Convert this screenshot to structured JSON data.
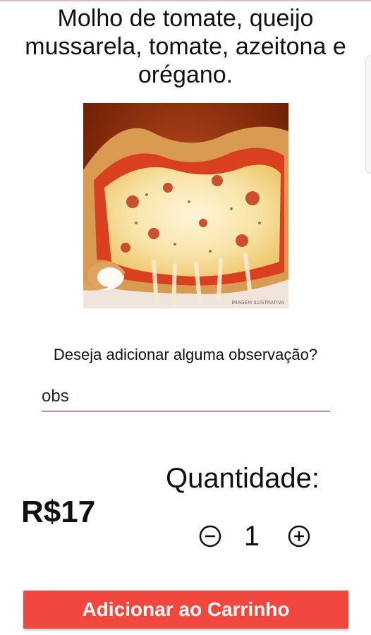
{
  "product": {
    "description": "Molho de tomate, queijo mussarela, tomate, azeitona e orégano.",
    "image_icon": "pizza-photo",
    "image_caption": "IMAGEM ILUSTRATIVA"
  },
  "observation": {
    "question": "Deseja adicionar alguma observação?",
    "value": "obs",
    "underline_color": "#c58a8e"
  },
  "price": {
    "label": "R$17"
  },
  "quantity": {
    "label": "Quantidade:",
    "value": "1",
    "decrease_icon": "minus-circle-icon",
    "increase_icon": "plus-circle-icon"
  },
  "cart": {
    "button_label": "Adicionar ao Carrinho",
    "button_color": "#f2473f"
  }
}
